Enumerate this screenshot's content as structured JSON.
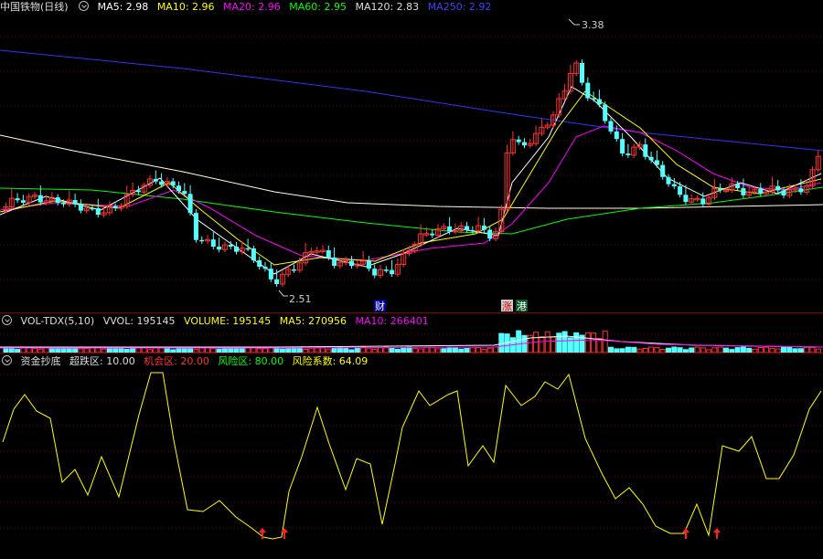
{
  "main_panel": {
    "stock_title": "中国铁物(日线)",
    "ma": [
      {
        "label": "MA5: 2.98",
        "color": "#ffffff"
      },
      {
        "label": "MA10: 2.96",
        "color": "#ffff00"
      },
      {
        "label": "MA20: 2.96",
        "color": "#ff00ff"
      },
      {
        "label": "MA60: 2.95",
        "color": "#00ff00"
      },
      {
        "label": "MA120: 2.83",
        "color": "#ffffff"
      },
      {
        "label": "MA250: 2.92",
        "color": "#3333ff"
      }
    ],
    "high_label": "3.38",
    "low_label": "2.51",
    "markers": {
      "cai": "财",
      "zhang": "涨",
      "gang": "港"
    }
  },
  "volume_panel": {
    "indicator": "VOL-TDX(5,10)",
    "vvol": "VVOL: 195145",
    "volume": "VOLUME: 195145",
    "ma5": "MA5: 270956",
    "ma10": "MA10: 266401"
  },
  "indicator_panel": {
    "name": "资金抄底",
    "super_low": "超跌区: 10.00",
    "chance": "机会区: 20.00",
    "risk": "风险区: 80.00",
    "coefficient": "风险系数: 64.09"
  },
  "colors": {
    "up": "#ff3232",
    "down": "#54ffff",
    "ma5": "#ffffff",
    "ma10": "#ffff00",
    "ma20": "#ff00ff",
    "ma60": "#00ff00",
    "ma120": "#ffffe0",
    "ma250": "#3333ff",
    "separator": "#8b0000"
  }
}
